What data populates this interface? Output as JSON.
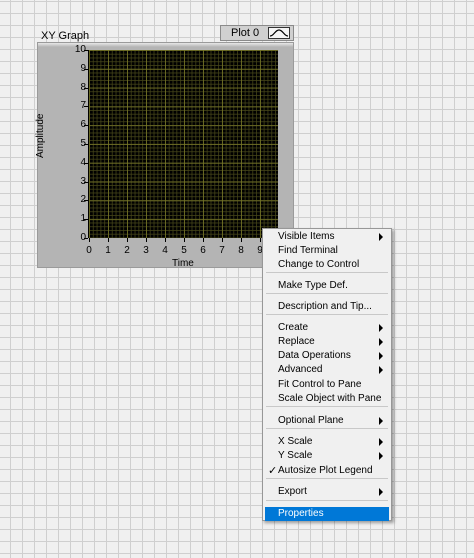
{
  "graph": {
    "title": "XY Graph",
    "legend": {
      "plot_name": "Plot 0",
      "swatch_icon": "waveform-icon"
    },
    "x_axis_label": "Time",
    "y_axis_label": "Amplitude",
    "x_ticks": [
      "0",
      "1",
      "2",
      "3",
      "4",
      "5",
      "6",
      "7",
      "8",
      "9"
    ],
    "y_ticks": [
      "10",
      "9",
      "8",
      "7",
      "6",
      "5",
      "4",
      "3",
      "2",
      "1",
      "0"
    ],
    "plot_background": "#000000",
    "grid_color": "#7a7a2a"
  },
  "context_menu": {
    "items": [
      {
        "label": "Visible Items",
        "submenu": true
      },
      {
        "label": "Find Terminal",
        "submenu": false
      },
      {
        "label": "Change to Control",
        "submenu": false
      },
      {
        "label": "Make Type Def.",
        "submenu": false
      },
      {
        "label": "Description and Tip...",
        "submenu": false
      },
      {
        "label": "Create",
        "submenu": true
      },
      {
        "label": "Replace",
        "submenu": true
      },
      {
        "label": "Data Operations",
        "submenu": true
      },
      {
        "label": "Advanced",
        "submenu": true
      },
      {
        "label": "Fit Control to Pane",
        "submenu": false
      },
      {
        "label": "Scale Object with Pane",
        "submenu": false
      },
      {
        "label": "Optional Plane",
        "submenu": true
      },
      {
        "label": "X Scale",
        "submenu": true
      },
      {
        "label": "Y Scale",
        "submenu": true
      },
      {
        "label": "Autosize Plot Legend",
        "submenu": false,
        "checked": true
      },
      {
        "label": "Export",
        "submenu": true
      },
      {
        "label": "Properties",
        "submenu": false,
        "highlighted": true
      }
    ],
    "highlight_color": "#0078d7"
  }
}
